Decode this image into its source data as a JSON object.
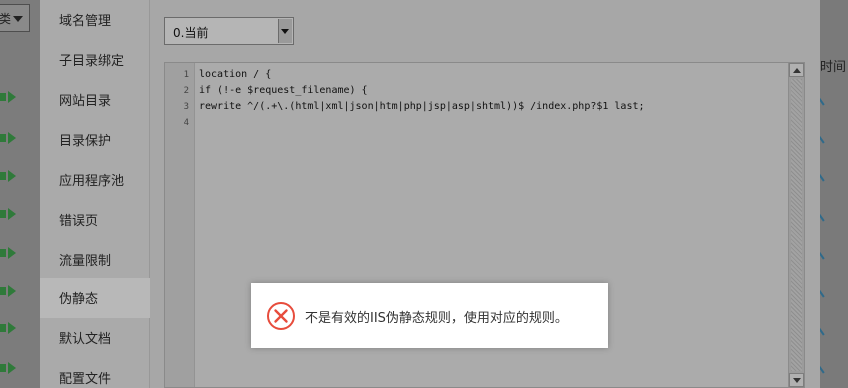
{
  "background": {
    "select_partial_text": "类",
    "right_header_partial": "时间"
  },
  "sidebar": {
    "items": [
      {
        "label": "域名管理"
      },
      {
        "label": "子目录绑定"
      },
      {
        "label": "网站目录"
      },
      {
        "label": "目录保护"
      },
      {
        "label": "应用程序池"
      },
      {
        "label": "错误页"
      },
      {
        "label": "流量限制"
      },
      {
        "label": "伪静态",
        "active": true
      },
      {
        "label": "默认文档"
      },
      {
        "label": "配置文件"
      }
    ]
  },
  "rewrite_select": {
    "value": "0.当前"
  },
  "editor": {
    "line_numbers": [
      "1",
      "2",
      "3",
      "4"
    ],
    "lines": [
      "location / {",
      "if (!-e $request_filename) {",
      "rewrite ^/(.+\\.(html|xml|json|htm|php|jsp|asp|shtml))$ /index.php?$1 last;",
      ""
    ]
  },
  "toast": {
    "icon": "error-circle-icon",
    "message": "不是有效的IIS伪静态规则，使用对应的规则。",
    "icon_color": "#e74c3c"
  }
}
